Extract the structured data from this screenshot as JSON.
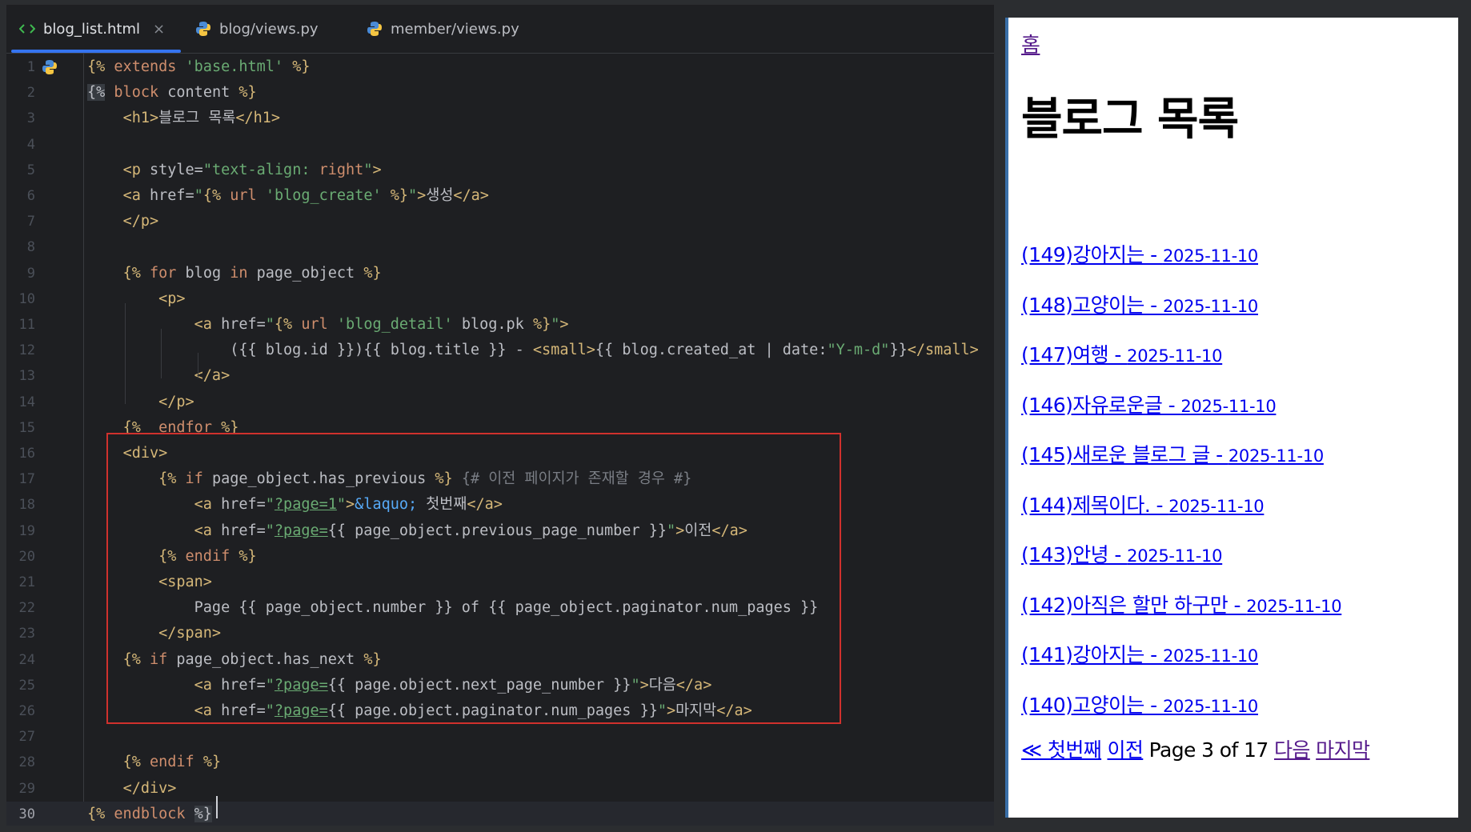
{
  "editor": {
    "tabs": [
      {
        "label": "blog_list.html",
        "icon": "html-file-icon",
        "active": true
      },
      {
        "label": "blog/views.py",
        "icon": "python-file-icon",
        "active": false
      },
      {
        "label": "member/views.py",
        "icon": "python-file-icon",
        "active": false
      }
    ],
    "close_glyph": "×",
    "lines": [
      {
        "n": "1",
        "tokens": [
          [
            "t-tag",
            "{%"
          ],
          [
            "t-def",
            " "
          ],
          [
            "t-kw",
            "extends"
          ],
          [
            "t-def",
            " "
          ],
          [
            "t-str",
            "'base.html'"
          ],
          [
            "t-def",
            " "
          ],
          [
            "t-tag",
            "%}"
          ]
        ]
      },
      {
        "n": "2",
        "tokens": [
          [
            "t-hl",
            "{%"
          ],
          [
            "t-def",
            " "
          ],
          [
            "t-kw",
            "block"
          ],
          [
            "t-def",
            " content "
          ],
          [
            "t-tag",
            "%}"
          ]
        ]
      },
      {
        "n": "3",
        "tokens": [
          [
            "t-def",
            "    "
          ],
          [
            "t-tag",
            "<h1>"
          ],
          [
            "t-def",
            "블로그 목록"
          ],
          [
            "t-tag",
            "</h1>"
          ]
        ]
      },
      {
        "n": "4",
        "tokens": []
      },
      {
        "n": "5",
        "tokens": [
          [
            "t-def",
            "    "
          ],
          [
            "t-tag",
            "<p "
          ],
          [
            "t-def",
            "style="
          ],
          [
            "t-str",
            "\"text-align: "
          ],
          [
            "t-kw",
            "right"
          ],
          [
            "t-str",
            "\""
          ],
          [
            "t-tag",
            ">"
          ]
        ]
      },
      {
        "n": "6",
        "tokens": [
          [
            "t-def",
            "    "
          ],
          [
            "t-tag",
            "<a "
          ],
          [
            "t-def",
            "href="
          ],
          [
            "t-str",
            "\""
          ],
          [
            "t-tag",
            "{%"
          ],
          [
            "t-def",
            " "
          ],
          [
            "t-kw",
            "url"
          ],
          [
            "t-def",
            " "
          ],
          [
            "t-str",
            "'blog_create'"
          ],
          [
            "t-def",
            " "
          ],
          [
            "t-tag",
            "%}"
          ],
          [
            "t-str",
            "\""
          ],
          [
            "t-tag",
            ">"
          ],
          [
            "t-def",
            "생성"
          ],
          [
            "t-tag",
            "</a>"
          ]
        ]
      },
      {
        "n": "7",
        "tokens": [
          [
            "t-def",
            "    "
          ],
          [
            "t-tag",
            "</p>"
          ]
        ]
      },
      {
        "n": "8",
        "tokens": []
      },
      {
        "n": "9",
        "tokens": [
          [
            "t-def",
            "    "
          ],
          [
            "t-tag",
            "{%"
          ],
          [
            "t-def",
            " "
          ],
          [
            "t-kw",
            "for"
          ],
          [
            "t-def",
            " blog "
          ],
          [
            "t-kw",
            "in"
          ],
          [
            "t-def",
            " page_object "
          ],
          [
            "t-tag",
            "%}"
          ]
        ]
      },
      {
        "n": "10",
        "tokens": [
          [
            "t-def",
            "        "
          ],
          [
            "t-tag",
            "<p>"
          ]
        ]
      },
      {
        "n": "11",
        "tokens": [
          [
            "t-def",
            "            "
          ],
          [
            "t-tag",
            "<a "
          ],
          [
            "t-def",
            "href="
          ],
          [
            "t-str",
            "\""
          ],
          [
            "t-tag",
            "{%"
          ],
          [
            "t-def",
            " "
          ],
          [
            "t-kw",
            "url"
          ],
          [
            "t-def",
            " "
          ],
          [
            "t-str",
            "'blog_detail'"
          ],
          [
            "t-def",
            " blog.pk "
          ],
          [
            "t-tag",
            "%}"
          ],
          [
            "t-str",
            "\""
          ],
          [
            "t-tag",
            ">"
          ]
        ]
      },
      {
        "n": "12",
        "tokens": [
          [
            "t-def",
            "                ({{ blog.id }}){{ blog.title }} - "
          ],
          [
            "t-tag",
            "<small>"
          ],
          [
            "t-def",
            "{{ blog.created_at | date:"
          ],
          [
            "t-str",
            "\"Y-m-d\""
          ],
          [
            "t-def",
            "}}"
          ],
          [
            "t-tag",
            "</small>"
          ]
        ]
      },
      {
        "n": "13",
        "tokens": [
          [
            "t-def",
            "            "
          ],
          [
            "t-tag",
            "</a>"
          ]
        ]
      },
      {
        "n": "14",
        "tokens": [
          [
            "t-def",
            "        "
          ],
          [
            "t-tag",
            "</p>"
          ]
        ]
      },
      {
        "n": "15",
        "tokens": [
          [
            "t-def",
            "    "
          ],
          [
            "t-tag",
            "{%"
          ],
          [
            "t-def",
            "  "
          ],
          [
            "t-kw",
            "endfor"
          ],
          [
            "t-def",
            " "
          ],
          [
            "t-tag",
            "%}"
          ]
        ]
      },
      {
        "n": "16",
        "tokens": [
          [
            "t-def",
            "    "
          ],
          [
            "t-tag",
            "<div>"
          ]
        ]
      },
      {
        "n": "17",
        "tokens": [
          [
            "t-def",
            "        "
          ],
          [
            "t-tag",
            "{%"
          ],
          [
            "t-def",
            " "
          ],
          [
            "t-kw",
            "if"
          ],
          [
            "t-def",
            " page_object.has_previous "
          ],
          [
            "t-tag",
            "%}"
          ],
          [
            "t-def",
            " "
          ],
          [
            "t-cmt",
            "{# 이전 페이지가 존재할 경우 #}"
          ]
        ]
      },
      {
        "n": "18",
        "tokens": [
          [
            "t-def",
            "            "
          ],
          [
            "t-tag",
            "<a "
          ],
          [
            "t-def",
            "href="
          ],
          [
            "t-str",
            "\""
          ],
          [
            "t-link",
            "?page=1"
          ],
          [
            "t-str",
            "\""
          ],
          [
            "t-tag",
            ">"
          ],
          [
            "t-ent",
            "&laquo;"
          ],
          [
            "t-def",
            " 첫번째"
          ],
          [
            "t-tag",
            "</a>"
          ]
        ]
      },
      {
        "n": "19",
        "tokens": [
          [
            "t-def",
            "            "
          ],
          [
            "t-tag",
            "<a "
          ],
          [
            "t-def",
            "href="
          ],
          [
            "t-str",
            "\""
          ],
          [
            "t-link",
            "?page="
          ],
          [
            "t-def",
            "{{ page_object.previous_page_number }}"
          ],
          [
            "t-str",
            "\""
          ],
          [
            "t-tag",
            ">"
          ],
          [
            "t-def",
            "이전"
          ],
          [
            "t-tag",
            "</a>"
          ]
        ]
      },
      {
        "n": "20",
        "tokens": [
          [
            "t-def",
            "        "
          ],
          [
            "t-tag",
            "{%"
          ],
          [
            "t-def",
            " "
          ],
          [
            "t-kw",
            "endif"
          ],
          [
            "t-def",
            " "
          ],
          [
            "t-tag",
            "%}"
          ]
        ]
      },
      {
        "n": "21",
        "tokens": [
          [
            "t-def",
            "        "
          ],
          [
            "t-tag",
            "<span>"
          ]
        ]
      },
      {
        "n": "22",
        "tokens": [
          [
            "t-def",
            "            Page {{ page_object.number }} of {{ page_object.paginator.num_pages }}"
          ]
        ]
      },
      {
        "n": "23",
        "tokens": [
          [
            "t-def",
            "        "
          ],
          [
            "t-tag",
            "</span>"
          ]
        ]
      },
      {
        "n": "24",
        "tokens": [
          [
            "t-def",
            "    "
          ],
          [
            "t-tag",
            "{%"
          ],
          [
            "t-def",
            " "
          ],
          [
            "t-kw",
            "if"
          ],
          [
            "t-def",
            " page_object.has_next "
          ],
          [
            "t-tag",
            "%}"
          ]
        ]
      },
      {
        "n": "25",
        "tokens": [
          [
            "t-def",
            "            "
          ],
          [
            "t-tag",
            "<a "
          ],
          [
            "t-def",
            "href="
          ],
          [
            "t-str",
            "\""
          ],
          [
            "t-link",
            "?page="
          ],
          [
            "t-def",
            "{{ page.object.next_page_number }}"
          ],
          [
            "t-str",
            "\""
          ],
          [
            "t-tag",
            ">"
          ],
          [
            "t-def",
            "다음"
          ],
          [
            "t-tag",
            "</a>"
          ]
        ]
      },
      {
        "n": "26",
        "tokens": [
          [
            "t-def",
            "            "
          ],
          [
            "t-tag",
            "<a "
          ],
          [
            "t-def",
            "href="
          ],
          [
            "t-str",
            "\""
          ],
          [
            "t-link",
            "?page="
          ],
          [
            "t-def",
            "{{ page.object.paginator.num_pages }}"
          ],
          [
            "t-str",
            "\""
          ],
          [
            "t-tag",
            ">"
          ],
          [
            "t-def",
            "마지막"
          ],
          [
            "t-tag",
            "</a>"
          ]
        ]
      },
      {
        "n": "27",
        "tokens": []
      },
      {
        "n": "28",
        "tokens": [
          [
            "t-def",
            "    "
          ],
          [
            "t-tag",
            "{%"
          ],
          [
            "t-def",
            " "
          ],
          [
            "t-kw",
            "endif"
          ],
          [
            "t-def",
            " "
          ],
          [
            "t-tag",
            "%}"
          ]
        ]
      },
      {
        "n": "29",
        "tokens": [
          [
            "t-def",
            "    "
          ],
          [
            "t-tag",
            "</div>"
          ]
        ]
      },
      {
        "n": "30",
        "tokens": [
          [
            "t-tag",
            "{%"
          ],
          [
            "t-def",
            " "
          ],
          [
            "t-kw",
            "endblock"
          ],
          [
            "t-def",
            " "
          ],
          [
            "t-hl",
            "%}"
          ]
        ]
      }
    ],
    "current_line": "30"
  },
  "preview": {
    "home_link": "홈",
    "title": "블로그 목록",
    "blogs": [
      {
        "text": "(149)강아지는 - ",
        "date": "2025-11-10"
      },
      {
        "text": "(148)고양이는 - ",
        "date": "2025-11-10"
      },
      {
        "text": "(147)여행 - ",
        "date": "2025-11-10"
      },
      {
        "text": "(146)자유로운글 - ",
        "date": "2025-11-10"
      },
      {
        "text": "(145)새로운 블로그 글 - ",
        "date": "2025-11-10"
      },
      {
        "text": "(144)제목이다. - ",
        "date": "2025-11-10"
      },
      {
        "text": "(143)안녕 - ",
        "date": "2025-11-10"
      },
      {
        "text": "(142)아직은 할만 하구만 - ",
        "date": "2025-11-10"
      },
      {
        "text": "(141)강아지는 - ",
        "date": "2025-11-10"
      },
      {
        "text": "(140)고양이는 - ",
        "date": "2025-11-10"
      }
    ],
    "pagination": {
      "first": "≪ 첫번째",
      "prev": "이전",
      "page_text": "Page 3 of 17",
      "next": "다음",
      "last": "마지막"
    }
  },
  "colors": {
    "editor_bg": "#1e1f22",
    "tag": "#d5b778",
    "string": "#6aab73",
    "keyword": "#cf8e6d",
    "highlight_box": "#d0312d",
    "link": "#0000ee",
    "visited_link": "#551a8b"
  }
}
